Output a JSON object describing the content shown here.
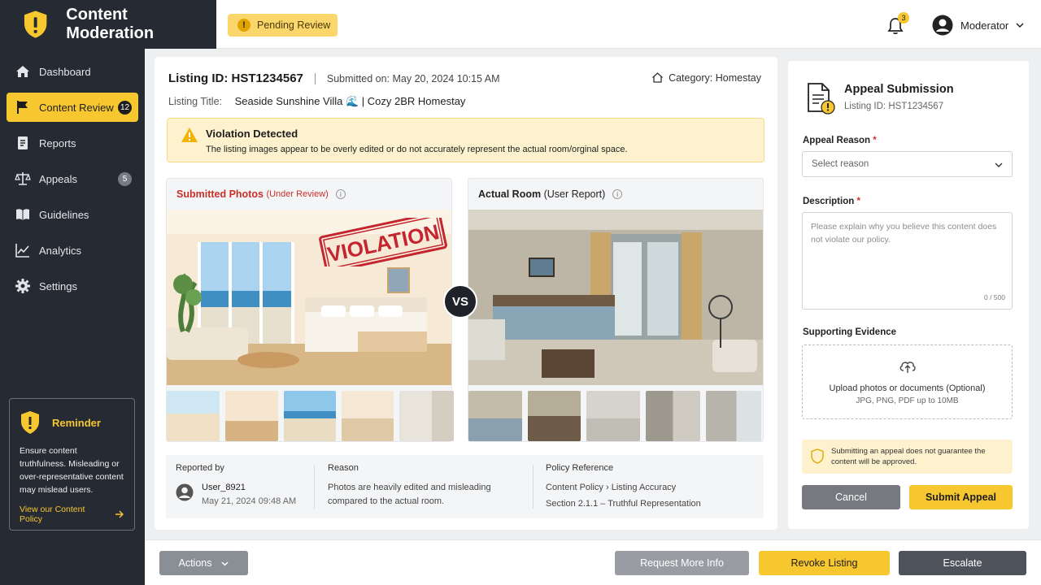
{
  "app": {
    "title": "Content Moderation"
  },
  "status_chip": {
    "label": "Pending Review",
    "icon": "exclamation-icon"
  },
  "notifications": {
    "count": "3"
  },
  "user": {
    "name": "Moderator"
  },
  "sidebar": {
    "items": [
      {
        "label": "Dashboard",
        "icon": "home-icon"
      },
      {
        "label": "Content Review",
        "icon": "flag-icon",
        "badge": "12",
        "active": true
      },
      {
        "label": "Reports",
        "icon": "document-icon"
      },
      {
        "label": "Appeals",
        "icon": "scales-icon",
        "badge": "5"
      },
      {
        "label": "Guidelines",
        "icon": "book-icon"
      },
      {
        "label": "Analytics",
        "icon": "chart-icon"
      },
      {
        "label": "Settings",
        "icon": "gear-icon"
      }
    ],
    "reminder": {
      "title": "Reminder",
      "text": "Ensure content truthfulness. Misleading or over-representative content may mislead users.",
      "link": "View our Content Policy"
    }
  },
  "listing": {
    "id_label": "Listing ID: HST1234567",
    "submitted": "Submitted on: May 20, 2024  10:15 AM",
    "category": "Category: Homestay",
    "title_label": "Listing Title:",
    "title": "Seaside Sunshine Villa 🌊  |  Cozy 2BR Homestay"
  },
  "violation": {
    "title": "Violation Detected",
    "description": "The listing images appear to be overly edited or do not accurately represent the actual room/orginal space."
  },
  "submitted_photos": {
    "title": "Submitted Photos",
    "subtitle": "(Under Review)",
    "stamp": "VIOLATION"
  },
  "actual_room": {
    "title": "Actual Room",
    "subtitle": "(User Report)"
  },
  "vs_label": "VS",
  "report": {
    "reported_by_label": "Reported by",
    "reporter": "User_8921",
    "reported_at": "May 21, 2024 09:48 AM",
    "reason_label": "Reason",
    "reason": "Photos are heavily edited and misleading compared to the actual room.",
    "policy_label": "Policy Reference",
    "policy_line1": "Content Policy › Listing Accuracy",
    "policy_line2": "Section 2.1.1 – Truthful Representation"
  },
  "appeal": {
    "title": "Appeal Submission",
    "subtitle": "Listing ID: HST1234567",
    "reason_label": "Appeal Reason",
    "reason_placeholder": "Select reason",
    "description_label": "Description",
    "description_placeholder": "Please explain why you believe this content does not violate our policy.",
    "counter": "0 / 500",
    "evidence_label": "Supporting Evidence",
    "upload_text": "Upload photos or documents (Optional)",
    "upload_hint": "JPG, PNG, PDF up to 10MB",
    "notice": "Submitting an appeal does not guarantee the content will be approved.",
    "cancel": "Cancel",
    "submit": "Submit Appeal"
  },
  "bottom_actions": {
    "actions": "Actions",
    "request_info": "Request More Info",
    "revoke": "Revoke Listing",
    "escalate": "Escalate"
  },
  "colors": {
    "accent": "#f7c730",
    "sidebar_bg": "#262b33",
    "danger": "#c6302b"
  }
}
